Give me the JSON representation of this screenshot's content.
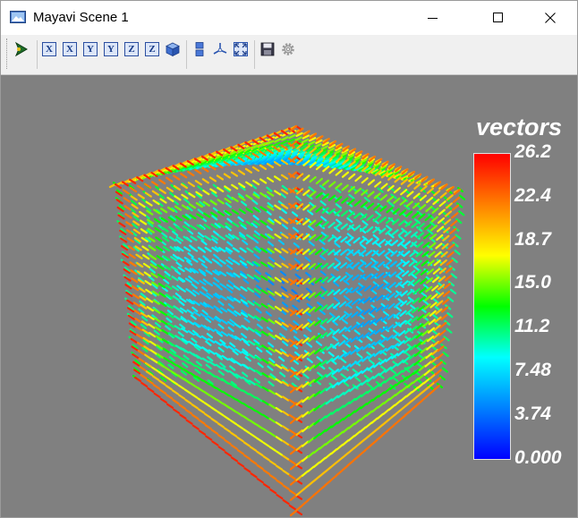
{
  "window": {
    "title": "Mayavi Scene 1"
  },
  "toolbar": {
    "buttons": [
      {
        "name": "mayavi-pipeline-icon"
      },
      {
        "name": "view-minus-x-icon",
        "label": "X"
      },
      {
        "name": "view-plus-x-icon",
        "label": "X"
      },
      {
        "name": "view-minus-y-icon",
        "label": "Y"
      },
      {
        "name": "view-plus-y-icon",
        "label": "Y"
      },
      {
        "name": "view-minus-z-icon",
        "label": "Z"
      },
      {
        "name": "view-plus-z-icon",
        "label": "Z"
      },
      {
        "name": "isometric-view-icon"
      },
      {
        "name": "toggle-parallel-projection-icon"
      },
      {
        "name": "toggle-axes-indicator-icon"
      },
      {
        "name": "full-screen-icon"
      },
      {
        "name": "save-icon"
      },
      {
        "name": "configure-scene-icon"
      }
    ]
  },
  "scene": {
    "background": "#808080",
    "colorbar": {
      "title": "vectors",
      "labels": [
        "26.2",
        "22.4",
        "18.7",
        "15.0",
        "11.2",
        "7.48",
        "3.74",
        "0.000"
      ],
      "colormap": [
        "#ff0000",
        "#ff8000",
        "#ffff00",
        "#00ff00",
        "#00ffff",
        "#0080ff",
        "#0000ff"
      ]
    }
  }
}
